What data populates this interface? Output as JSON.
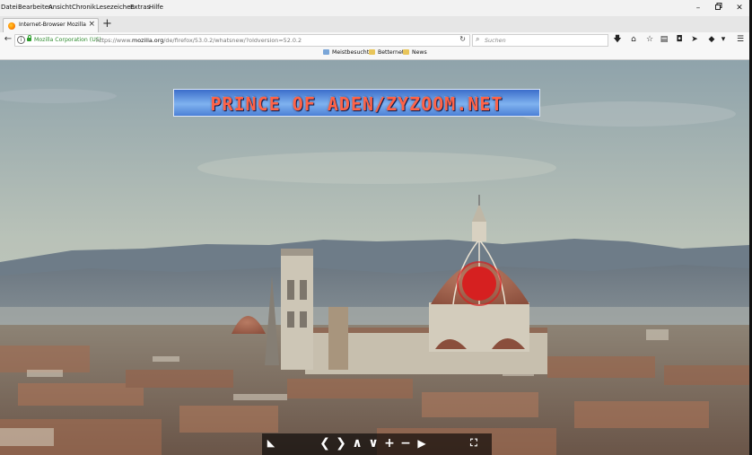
{
  "menubar": {
    "items": [
      "Datei",
      "Bearbeiten",
      "Ansicht",
      "Chronik",
      "Lesezeichen",
      "Extras",
      "Hilfe"
    ]
  },
  "window_controls": [
    "minimize",
    "maximize",
    "close"
  ],
  "tab": {
    "title": "Internet-Browser Mozilla Fire",
    "favicon": "firefox-icon"
  },
  "urlbar": {
    "identity": "Mozilla Corporation (US)",
    "url_prefix": "https://www.",
    "url_domain": "mozilla.org",
    "url_path": "/de/firefox/53.0.2/whatsnew/?oldversion=52.0.2"
  },
  "search": {
    "placeholder": "Suchen"
  },
  "toolbar": {
    "icons": [
      "download-icon",
      "home-icon",
      "bookmark-star-icon",
      "library-icon",
      "pocket-icon",
      "send-icon",
      "extension-icon",
      "overflow-icon",
      "menu-icon"
    ]
  },
  "bookmarks": {
    "items": [
      "Meistbesucht",
      "Betternet",
      "News"
    ]
  },
  "webcam": {
    "banner_text": "PRINCE OF ADEN/ZYZOOM.NET",
    "controls": [
      "draw-icon",
      "prev-icon",
      "next-icon",
      "up-icon",
      "down-icon",
      "zoom-in-icon",
      "zoom-out-icon",
      "play-icon",
      "fullscreen-icon"
    ]
  },
  "colors": {
    "identity_green": "#2e8b2e",
    "banner_blue": "#4c80d6",
    "banner_text": "#ff6347",
    "marker_red": "#d62020"
  }
}
